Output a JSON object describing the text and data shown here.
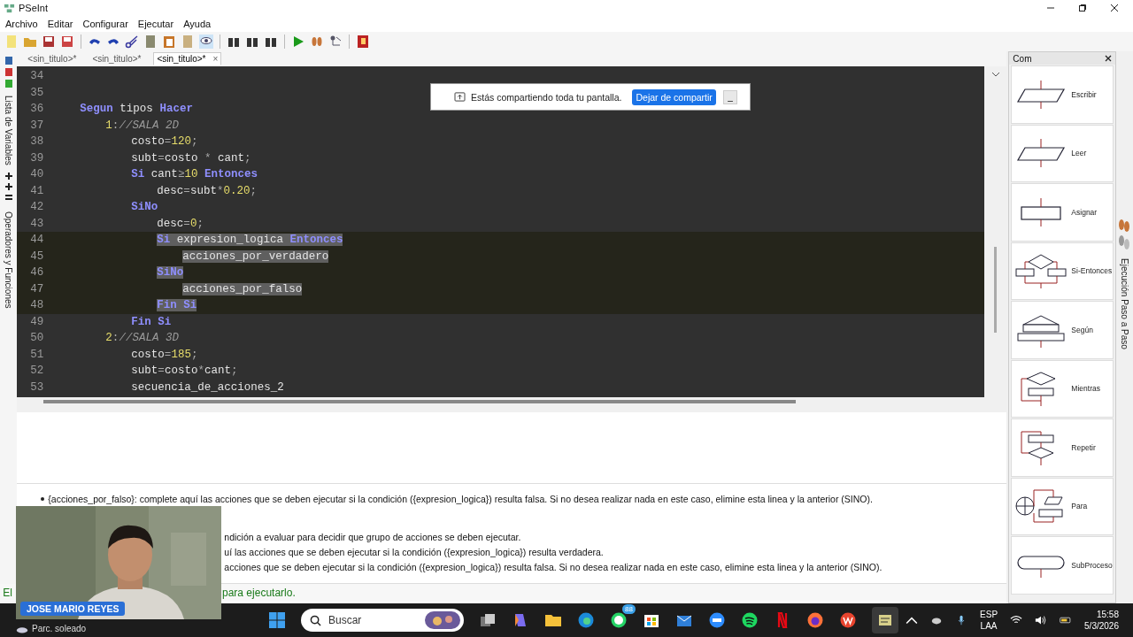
{
  "window": {
    "title": "PSeInt"
  },
  "menu": [
    "Archivo",
    "Editar",
    "Configurar",
    "Ejecutar",
    "Ayuda"
  ],
  "left_tabs": [
    "Lista de Variables",
    "Operadores y Funciones"
  ],
  "tabs": [
    {
      "label": "<sin_titulo>*",
      "selected": false
    },
    {
      "label": "<sin_titulo>*",
      "selected": false
    },
    {
      "label": "<sin_titulo>*",
      "selected": true,
      "close": "×"
    }
  ],
  "editor": {
    "lines": [
      {
        "number": "34",
        "selected": false
      },
      {
        "number": "35",
        "selected": false
      },
      {
        "number": "36",
        "selected": false,
        "tokens": [
          {
            "kind": "kw",
            "text": "Segun"
          },
          {
            "kind": "id",
            "text": " tipos "
          },
          {
            "kind": "kw",
            "text": "Hacer"
          }
        ],
        "children": [
          {
            "number": "37",
            "selected": false,
            "tokens": [
              {
                "kind": "num",
                "text": "1"
              },
              {
                "kind": "op",
                "text": ":"
              },
              {
                "kind": "cm",
                "text": "//SALA 2D"
              }
            ],
            "children": [
              {
                "number": "38",
                "selected": false,
                "tokens": [
                  {
                    "kind": "id",
                    "text": "costo"
                  },
                  {
                    "kind": "op",
                    "text": "="
                  },
                  {
                    "kind": "num",
                    "text": "120"
                  },
                  {
                    "kind": "op",
                    "text": ";"
                  }
                ]
              },
              {
                "number": "39",
                "selected": false,
                "tokens": [
                  {
                    "kind": "id",
                    "text": "subt"
                  },
                  {
                    "kind": "op",
                    "text": "="
                  },
                  {
                    "kind": "id",
                    "text": "costo "
                  },
                  {
                    "kind": "op",
                    "text": "*"
                  },
                  {
                    "kind": "id",
                    "text": " cant"
                  },
                  {
                    "kind": "op",
                    "text": ";"
                  }
                ]
              },
              {
                "number": "40",
                "selected": false,
                "tokens": [
                  {
                    "kind": "kw",
                    "text": "Si"
                  },
                  {
                    "kind": "id",
                    "text": " cant"
                  },
                  {
                    "kind": "op",
                    "text": "≥"
                  },
                  {
                    "kind": "num",
                    "text": "10"
                  },
                  {
                    "kind": "kw",
                    "text": " Entonces"
                  }
                ],
                "children": [
                  {
                    "number": "41",
                    "selected": false,
                    "tokens": [
                      {
                        "kind": "id",
                        "text": "desc"
                      },
                      {
                        "kind": "op",
                        "text": "="
                      },
                      {
                        "kind": "id",
                        "text": "subt"
                      },
                      {
                        "kind": "op",
                        "text": "*"
                      },
                      {
                        "kind": "num",
                        "text": "0.20"
                      },
                      {
                        "kind": "op",
                        "text": ";"
                      }
                    ]
                  }
                ]
              },
              {
                "number": "42",
                "selected": false,
                "tokens": [
                  {
                    "kind": "kw",
                    "text": "SiNo"
                  }
                ],
                "children": [
                  {
                    "number": "43",
                    "selected": false,
                    "tokens": [
                      {
                        "kind": "id",
                        "text": "desc"
                      },
                      {
                        "kind": "op",
                        "text": "="
                      },
                      {
                        "kind": "num",
                        "text": "0"
                      },
                      {
                        "kind": "op",
                        "text": ";"
                      }
                    ]
                  },
                  {
                    "number": "44",
                    "selected": true,
                    "tokens": [
                      {
                        "kind": "kw",
                        "text": "Si"
                      },
                      {
                        "kind": "id",
                        "text": " expresion_logica "
                      },
                      {
                        "kind": "kw",
                        "text": "Entonces"
                      }
                    ],
                    "children": [
                      {
                        "number": "45",
                        "selected": true,
                        "tokens": [
                          {
                            "kind": "id",
                            "text": "acciones_por_verdadero"
                          }
                        ]
                      }
                    ]
                  },
                  {
                    "number": "46",
                    "selected": true,
                    "tokens": [
                      {
                        "kind": "kw",
                        "text": "SiNo"
                      }
                    ],
                    "children": [
                      {
                        "number": "47",
                        "selected": true,
                        "tokens": [
                          {
                            "kind": "id",
                            "text": "acciones_por_falso"
                          }
                        ]
                      }
                    ]
                  },
                  {
                    "number": "48",
                    "selected": true,
                    "tokens": [
                      {
                        "kind": "kw",
                        "text": "Fin Si"
                      }
                    ]
                  }
                ]
              },
              {
                "number": "49",
                "selected": false,
                "tokens": [
                  {
                    "kind": "kw",
                    "text": "Fin Si"
                  }
                ]
              }
            ]
          },
          {
            "number": "50",
            "selected": false,
            "tokens": [
              {
                "kind": "num",
                "text": "2"
              },
              {
                "kind": "op",
                "text": ":"
              },
              {
                "kind": "cm",
                "text": "//SALA 3D"
              }
            ],
            "children": [
              {
                "number": "51",
                "selected": false,
                "tokens": [
                  {
                    "kind": "id",
                    "text": "costo"
                  },
                  {
                    "kind": "op",
                    "text": "="
                  },
                  {
                    "kind": "num",
                    "text": "185"
                  },
                  {
                    "kind": "op",
                    "text": ";"
                  }
                ]
              },
              {
                "number": "52",
                "selected": false,
                "tokens": [
                  {
                    "kind": "id",
                    "text": "subt"
                  },
                  {
                    "kind": "op",
                    "text": "="
                  },
                  {
                    "kind": "id",
                    "text": "costo"
                  },
                  {
                    "kind": "op",
                    "text": "*"
                  },
                  {
                    "kind": "id",
                    "text": "cant"
                  },
                  {
                    "kind": "op",
                    "text": ";"
                  }
                ]
              },
              {
                "number": "53",
                "selected": false,
                "tokens": [
                  {
                    "kind": "id",
                    "text": "secuencia_de_acciones_2"
                  }
                ]
              }
            ]
          }
        ]
      }
    ]
  },
  "share_bar": {
    "message": "Estás compartiendo toda tu pantalla.",
    "stop_button": "Dejar de compartir",
    "minimize": "_"
  },
  "help": {
    "lines": [
      {
        "kind": "bullet",
        "text": "{acciones_por_falso}: complete aquí las acciones que se deben ejecutar si la condición ({expresion_logica}) resulta falsa. Si no desea realizar nada en este caso, elimine esta linea y la anterior (SINO)."
      },
      {
        "kind": "covered",
        "text": "ndición a evaluar para decidir que grupo de acciones se deben ejecutar."
      },
      {
        "kind": "covered",
        "text": "uí las acciones que se deben ejecutar si la condición ({expresion_logica}) resulta verdadera."
      },
      {
        "kind": "covered",
        "text": "acciones que se deben ejecutar si la condición ({expresion_logica}) resulta falsa. Si no desea realizar nada en este caso, elimine esta linea y la anterior (SINO)."
      }
    ]
  },
  "status_bar": {
    "left": "El",
    "right": "para ejecutarlo."
  },
  "commands": {
    "title": "Com",
    "items": [
      {
        "label": "Escribir"
      },
      {
        "label": "Leer"
      },
      {
        "label": "Asignar"
      },
      {
        "label": "Si-Entonces"
      },
      {
        "label": "Según"
      },
      {
        "label": "Mientras"
      },
      {
        "label": "Repetir"
      },
      {
        "label": "Para"
      },
      {
        "label": "SubProceso"
      }
    ]
  },
  "right_tab": "Ejecución Paso a Paso",
  "webcam": {
    "kind": "picture",
    "name": "JOSE MARIO REYES"
  },
  "taskbar": {
    "weather": "Parc. soleado",
    "search_placeholder": "Buscar",
    "whatsapp_badge": "88",
    "language": "ESP",
    "layout": "LAA",
    "time": "15:58",
    "date": "5/3/2026"
  }
}
